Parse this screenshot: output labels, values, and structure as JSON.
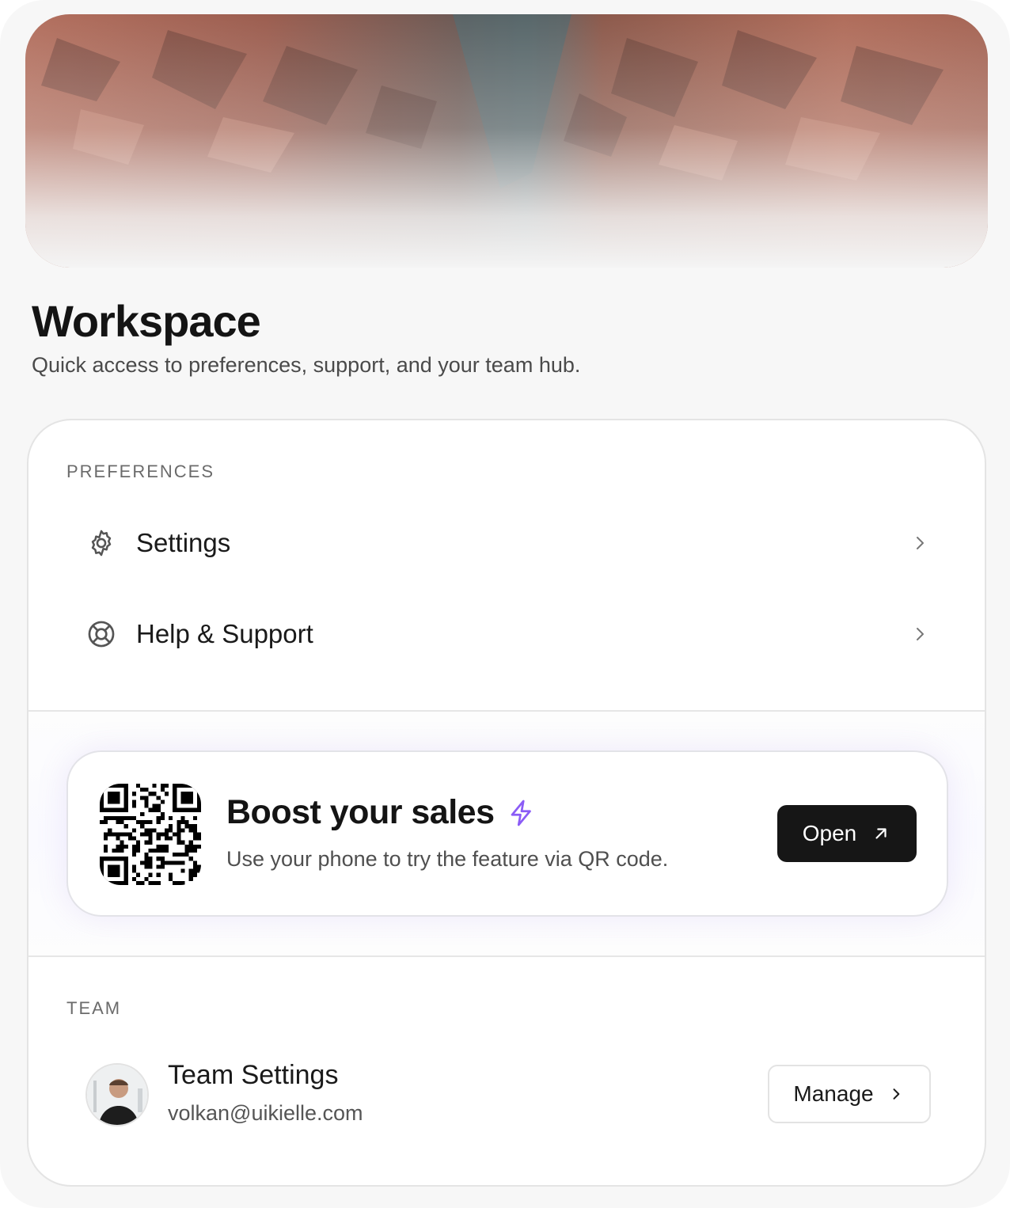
{
  "page": {
    "title": "Workspace",
    "subtitle": "Quick access to preferences, support, and your team hub."
  },
  "preferences": {
    "section_label": "PREFERENCES",
    "items": [
      {
        "label": "Settings",
        "icon": "gear-icon"
      },
      {
        "label": "Help & Support",
        "icon": "lifebuoy-icon"
      }
    ]
  },
  "promo": {
    "title": "Boost your sales",
    "description": "Use your phone to try the feature via QR code.",
    "button_label": "Open",
    "accent_color": "#8b5cf6",
    "icon": "lightning-icon"
  },
  "team": {
    "section_label": "TEAM",
    "name": "Team Settings",
    "email": "volkan@uikielle.com",
    "button_label": "Manage"
  },
  "colors": {
    "primary_button": "#161616",
    "background": "#f7f7f7"
  }
}
